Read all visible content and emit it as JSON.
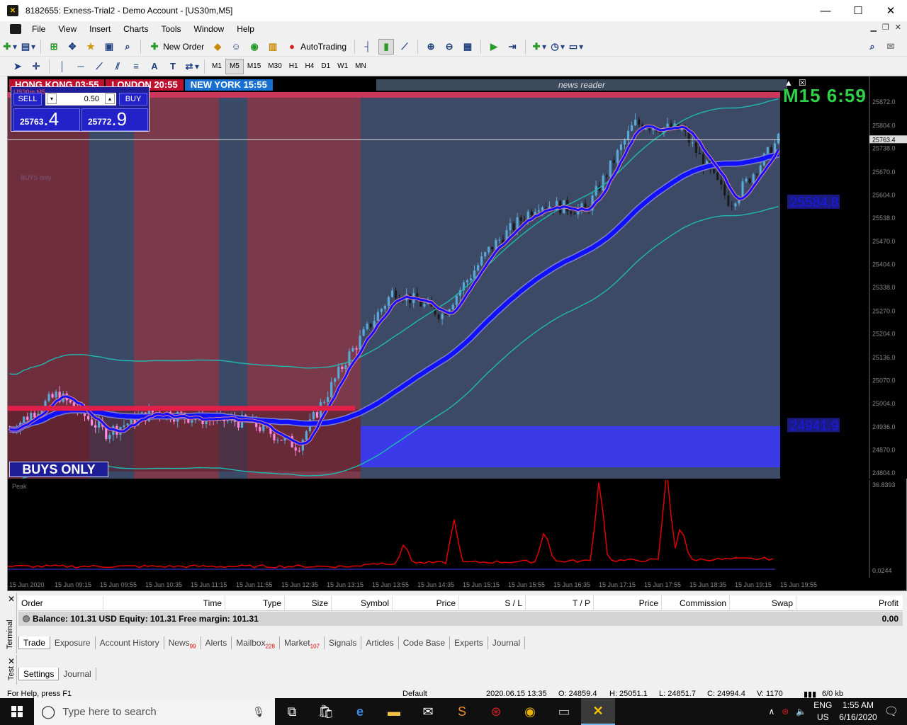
{
  "window": {
    "title": "8182655: Exness-Trial2 - Demo Account - [US30m,M5]",
    "minimize": "—",
    "maximize": "☐",
    "close": "✕"
  },
  "menu": {
    "items": [
      "File",
      "View",
      "Insert",
      "Charts",
      "Tools",
      "Window",
      "Help"
    ]
  },
  "toolbar": {
    "new_order": "New Order",
    "autotrading": "AutoTrading",
    "timeframes": [
      "M1",
      "M5",
      "M15",
      "M30",
      "H1",
      "H4",
      "D1",
      "W1",
      "MN"
    ],
    "active_timeframe": "M5"
  },
  "chart": {
    "symbol_label": "US30m,M5",
    "sessions": [
      {
        "label": "HONG KONG 03:55",
        "color": "#c01030"
      },
      {
        "label": "LONDON  20:55",
        "color": "#c01030"
      },
      {
        "label": "NEW YORK  15:55",
        "color": "#1a70d0"
      }
    ],
    "news_reader": "news reader",
    "timer": "M15 6:59",
    "one_click": {
      "sell_label": "SELL",
      "buy_label": "BUY",
      "lot": "0.50",
      "bid_main": "25763",
      "bid_big": ".4",
      "ask_main": "25772",
      "ask_big": ".9"
    },
    "buys_only_badge": "BUYS ONLY",
    "buys_only_small": "BUYS only",
    "level_upper": "25584.8",
    "level_lower": "24941.9",
    "current_price": "25763.4",
    "price_axis": [
      "25872.0",
      "25804.0",
      "25738.0",
      "25670.0",
      "25604.0",
      "25538.0",
      "25470.0",
      "25404.0",
      "25338.0",
      "25270.0",
      "25204.0",
      "25136.0",
      "25070.0",
      "25004.0",
      "24936.0",
      "24870.0",
      "24804.0"
    ],
    "indicator_name": "Peak",
    "indicator_max": "36.8393",
    "indicator_min": "0.0244",
    "time_axis": [
      "15 Jun 2020",
      "15 Jun 09:15",
      "15 Jun 09:55",
      "15 Jun 10:35",
      "15 Jun 11:15",
      "15 Jun 11:55",
      "15 Jun 12:35",
      "15 Jun 13:15",
      "15 Jun 13:55",
      "15 Jun 14:35",
      "15 Jun 15:15",
      "15 Jun 15:55",
      "15 Jun 16:35",
      "15 Jun 17:15",
      "15 Jun 17:55",
      "15 Jun 18:35",
      "15 Jun 19:15",
      "15 Jun 19:55"
    ]
  },
  "terminal": {
    "side_label": "Terminal",
    "columns": [
      "Order",
      "Time",
      "Type",
      "Size",
      "Symbol",
      "Price",
      "S / L",
      "T / P",
      "Price",
      "Commission",
      "Swap",
      "Profit"
    ],
    "balance_text": "Balance: 101.31 USD  Equity: 101.31  Free margin: 101.31",
    "profit_total": "0.00",
    "tabs": [
      {
        "label": "Trade",
        "badge": ""
      },
      {
        "label": "Exposure",
        "badge": ""
      },
      {
        "label": "Account History",
        "badge": ""
      },
      {
        "label": "News",
        "badge": "99"
      },
      {
        "label": "Alerts",
        "badge": ""
      },
      {
        "label": "Mailbox",
        "badge": "228"
      },
      {
        "label": "Market",
        "badge": "107"
      },
      {
        "label": "Signals",
        "badge": ""
      },
      {
        "label": "Articles",
        "badge": ""
      },
      {
        "label": "Code Base",
        "badge": ""
      },
      {
        "label": "Experts",
        "badge": ""
      },
      {
        "label": "Journal",
        "badge": ""
      }
    ]
  },
  "tester": {
    "side_label": "Test",
    "tabs": [
      "Settings",
      "Journal"
    ]
  },
  "statusbar": {
    "help": "For Help, press F1",
    "profile": "Default",
    "datetime": "2020.06.15 13:35",
    "open": "O: 24859.4",
    "high": "H: 25051.1",
    "low": "L: 24851.7",
    "close": "C: 24994.4",
    "volume": "V: 1170",
    "traffic": "6/0 kb"
  },
  "taskbar": {
    "search_placeholder": "Type here to search",
    "lang": "ENG",
    "region": "US",
    "time": "1:55 AM",
    "date": "6/16/2020"
  },
  "colors": {
    "chart_bg": "#000000",
    "bull_candle": "#5aa8d8",
    "bear_candle": "#ff88e0",
    "ma_blue": "#1010ff",
    "ma_red": "#e0204a",
    "band": "#20b8b0",
    "peak_line": "#e00000"
  },
  "chart_data": {
    "type": "line",
    "title": "",
    "close_path": [
      {
        "x": "15 Jun 09:15",
        "y": 24930
      },
      {
        "x": "15 Jun 09:55",
        "y": 25030
      },
      {
        "x": "15 Jun 10:35",
        "y": 24920
      },
      {
        "x": "15 Jun 11:15",
        "y": 24980
      },
      {
        "x": "15 Jun 11:55",
        "y": 24960
      },
      {
        "x": "15 Jun 12:35",
        "y": 24950
      },
      {
        "x": "15 Jun 13:15",
        "y": 24880
      },
      {
        "x": "15 Jun 13:55",
        "y": 25130
      },
      {
        "x": "15 Jun 14:35",
        "y": 25330
      },
      {
        "x": "15 Jun 15:15",
        "y": 25260
      },
      {
        "x": "15 Jun 15:55",
        "y": 25450
      },
      {
        "x": "15 Jun 16:35",
        "y": 25580
      },
      {
        "x": "15 Jun 17:15",
        "y": 25560
      },
      {
        "x": "15 Jun 17:55",
        "y": 25810
      },
      {
        "x": "15 Jun 18:35",
        "y": 25790
      },
      {
        "x": "15 Jun 19:15",
        "y": 25580
      },
      {
        "x": "15 Jun 19:55",
        "y": 25763.4
      }
    ],
    "ylim": [
      24804,
      25872
    ]
  }
}
